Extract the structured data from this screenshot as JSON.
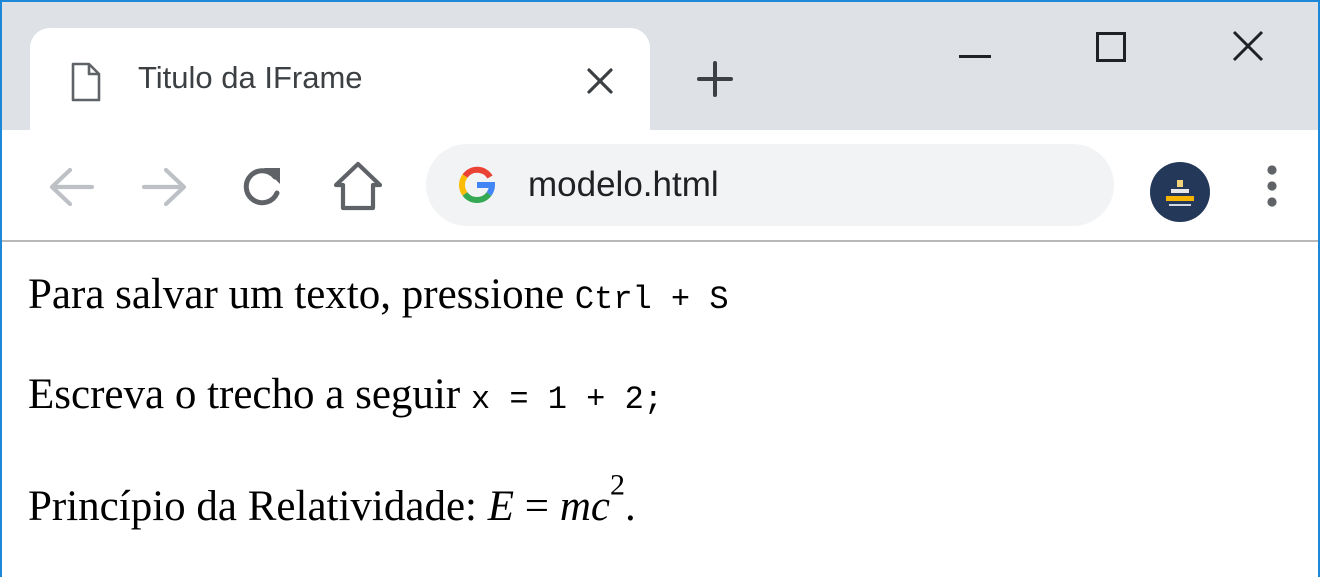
{
  "tab": {
    "title": "Titulo da IFrame",
    "icon": "page-icon"
  },
  "window_controls": {
    "minimize_icon": "minimize-icon",
    "maximize_icon": "maximize-icon",
    "close_icon": "close-icon"
  },
  "toolbar": {
    "back_icon": "arrow-left-icon",
    "forward_icon": "arrow-right-icon",
    "reload_icon": "reload-icon",
    "home_icon": "home-icon",
    "url": "modelo.html",
    "search_engine_icon": "google-icon",
    "menu_icon": "kebab-menu-icon"
  },
  "content": {
    "line1": {
      "text": "Para salvar um texto, pressione ",
      "keys": "Ctrl + S"
    },
    "line2": {
      "text": "Escreva o trecho a seguir ",
      "code": "x = 1 + 2;"
    },
    "line3": {
      "text": "Princípio da Relatividade: ",
      "var_e": "E",
      "equals": " = ",
      "var_mc": "mc",
      "exponent": "2",
      "end": "."
    }
  },
  "colors": {
    "titlebar": "#dee1e6",
    "window_border": "#1e88d8",
    "omnibox": "#f1f3f4",
    "avatar": "#24395a"
  }
}
